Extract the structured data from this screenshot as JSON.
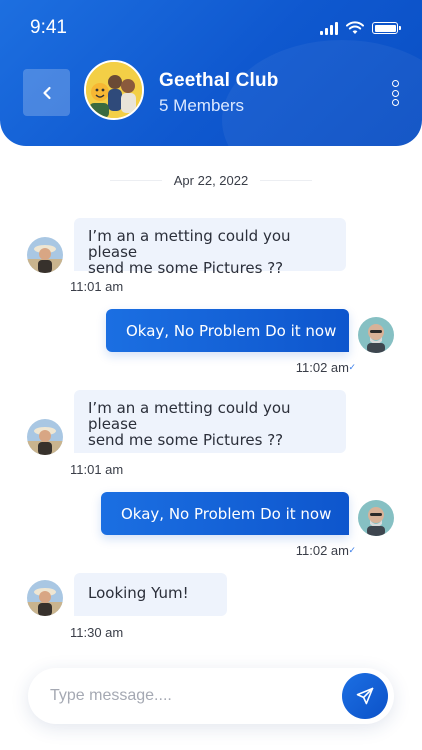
{
  "status_bar": {
    "time": "9:41"
  },
  "header": {
    "group_name": "Geethal Club",
    "members": "5 Members"
  },
  "chat": {
    "date": "Apr 22, 2022",
    "messages": [
      {
        "direction": "incoming",
        "text_line1": "I’m an a metting could you please",
        "text_line2": "send me some Pictures ??",
        "time": "11:01 am"
      },
      {
        "direction": "outgoing",
        "text": "Okay, No Problem Do it now",
        "time": "11:02 am"
      },
      {
        "direction": "incoming",
        "text_line1": "I’m an a metting could you please",
        "text_line2": "send me some Pictures ??",
        "time": "11:01 am"
      },
      {
        "direction": "outgoing",
        "text": "Okay, No Problem Do it now",
        "time": "11:02 am"
      },
      {
        "direction": "incoming",
        "text_line1": "Looking Yum!",
        "time": "11:30 am"
      }
    ]
  },
  "composer": {
    "placeholder": "Type message...."
  },
  "colors": {
    "primary": "#1160d8",
    "bubble_in": "#eef3fc",
    "background": "#ffffff"
  },
  "icons": [
    "back-chevron-icon",
    "more-vertical-icon",
    "send-icon",
    "signal-icon",
    "wifi-icon",
    "battery-icon",
    "read-tick-icon"
  ]
}
